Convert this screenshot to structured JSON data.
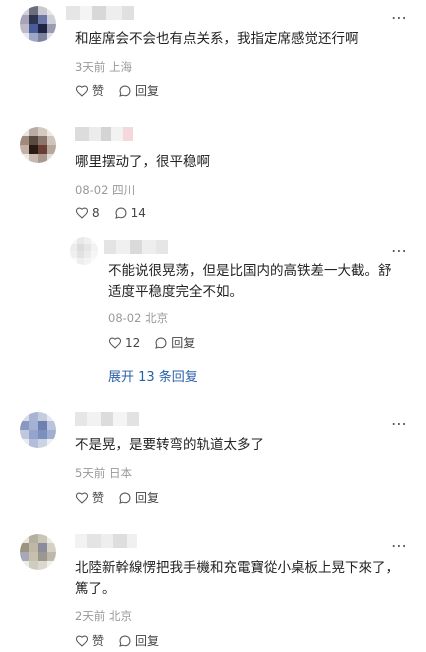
{
  "comments": [
    {
      "text_lines": [
        "和座席会不会也有点关系，我指定席感觉还行啊"
      ],
      "meta": "3天前 上海",
      "like_label": "赞",
      "reply_label": "回复"
    },
    {
      "text_lines": [
        "哪里摆动了，很平稳啊"
      ],
      "meta": "08-02 四川",
      "like_label": "8",
      "reply_label": "14"
    },
    {
      "text_lines": [
        "不能说很晃荡，但是比国内的高铁差一大截。舒",
        "适度平稳度完全不如。"
      ],
      "meta": "08-02 北京",
      "like_label": "12",
      "reply_label": "回复"
    },
    {
      "text_lines": [
        "不是晃，是要转弯的轨道太多了"
      ],
      "meta": "5天前 日本",
      "like_label": "赞",
      "reply_label": "回复"
    },
    {
      "text_lines": [
        "北陸新幹線愣把我手機和充電寶從小桌板上晃下來了，",
        "篤了。"
      ],
      "meta": "2天前 北京",
      "like_label": "赞",
      "reply_label": "回复"
    }
  ],
  "expand_label": "展开 13 条回复",
  "more_icon": "⋯",
  "icons": {
    "like": "heart-outline-icon",
    "reply": "speech-bubble-icon",
    "more": "more-dots-icon"
  }
}
